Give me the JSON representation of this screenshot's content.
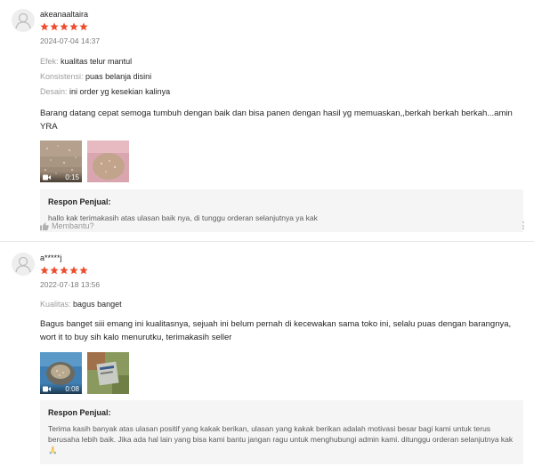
{
  "colors": {
    "star": "#ee4d2d",
    "response_bg": "#f5f5f5",
    "muted": "#999999"
  },
  "reviews": [
    {
      "username": "akeanaaltaira",
      "rating": 5,
      "datetime": "2024-07-04 14:37",
      "attributes": [
        {
          "key": "Efek:",
          "value": "kualitas telur mantul"
        },
        {
          "key": "Konsistensi:",
          "value": "puas belanja disini"
        },
        {
          "key": "Desain:",
          "value": "ini order yg kesekian kalinya"
        }
      ],
      "text": "Barang datang cepat semoga tumbuh dengan baik dan bisa panen dengan hasil yg memuaskan,,berkah berkah berkah...amin YRA",
      "media": [
        {
          "type": "video",
          "duration": "0:15",
          "icon": "video-camera-icon"
        },
        {
          "type": "image"
        }
      ],
      "response_title": "Respon Penjual:",
      "response_text": "hallo kak terimakasih atas ulasan baik nya, di tunggu orderan selanjutnya ya kak",
      "helpful_label": "Membantu?"
    },
    {
      "username": "a*****j",
      "rating": 5,
      "datetime": "2022-07-18 13:56",
      "attributes": [
        {
          "key": "Kualitas:",
          "value": "bagus banget"
        }
      ],
      "text": "Bagus banget siii emang ini kualitasnya, sejuah ini belum pernah di kecewakan sama toko ini, selalu puas dengan barangnya, wort it to buy sih kalo menurutku, terimakasih seller",
      "media": [
        {
          "type": "video",
          "duration": "0:08",
          "icon": "video-camera-icon"
        },
        {
          "type": "image"
        }
      ],
      "response_title": "Respon Penjual:",
      "response_text": "Terima kasih banyak atas ulasan positif yang kakak berikan, ulasan yang kakak berikan adalah motivasi besar bagi kami untuk terus berusaha lebih baik. Jika ada hal lain yang bisa kami bantu jangan ragu untuk menghubungi admin kami. ditunggu orderan selanjutnya kak🙏"
    }
  ]
}
